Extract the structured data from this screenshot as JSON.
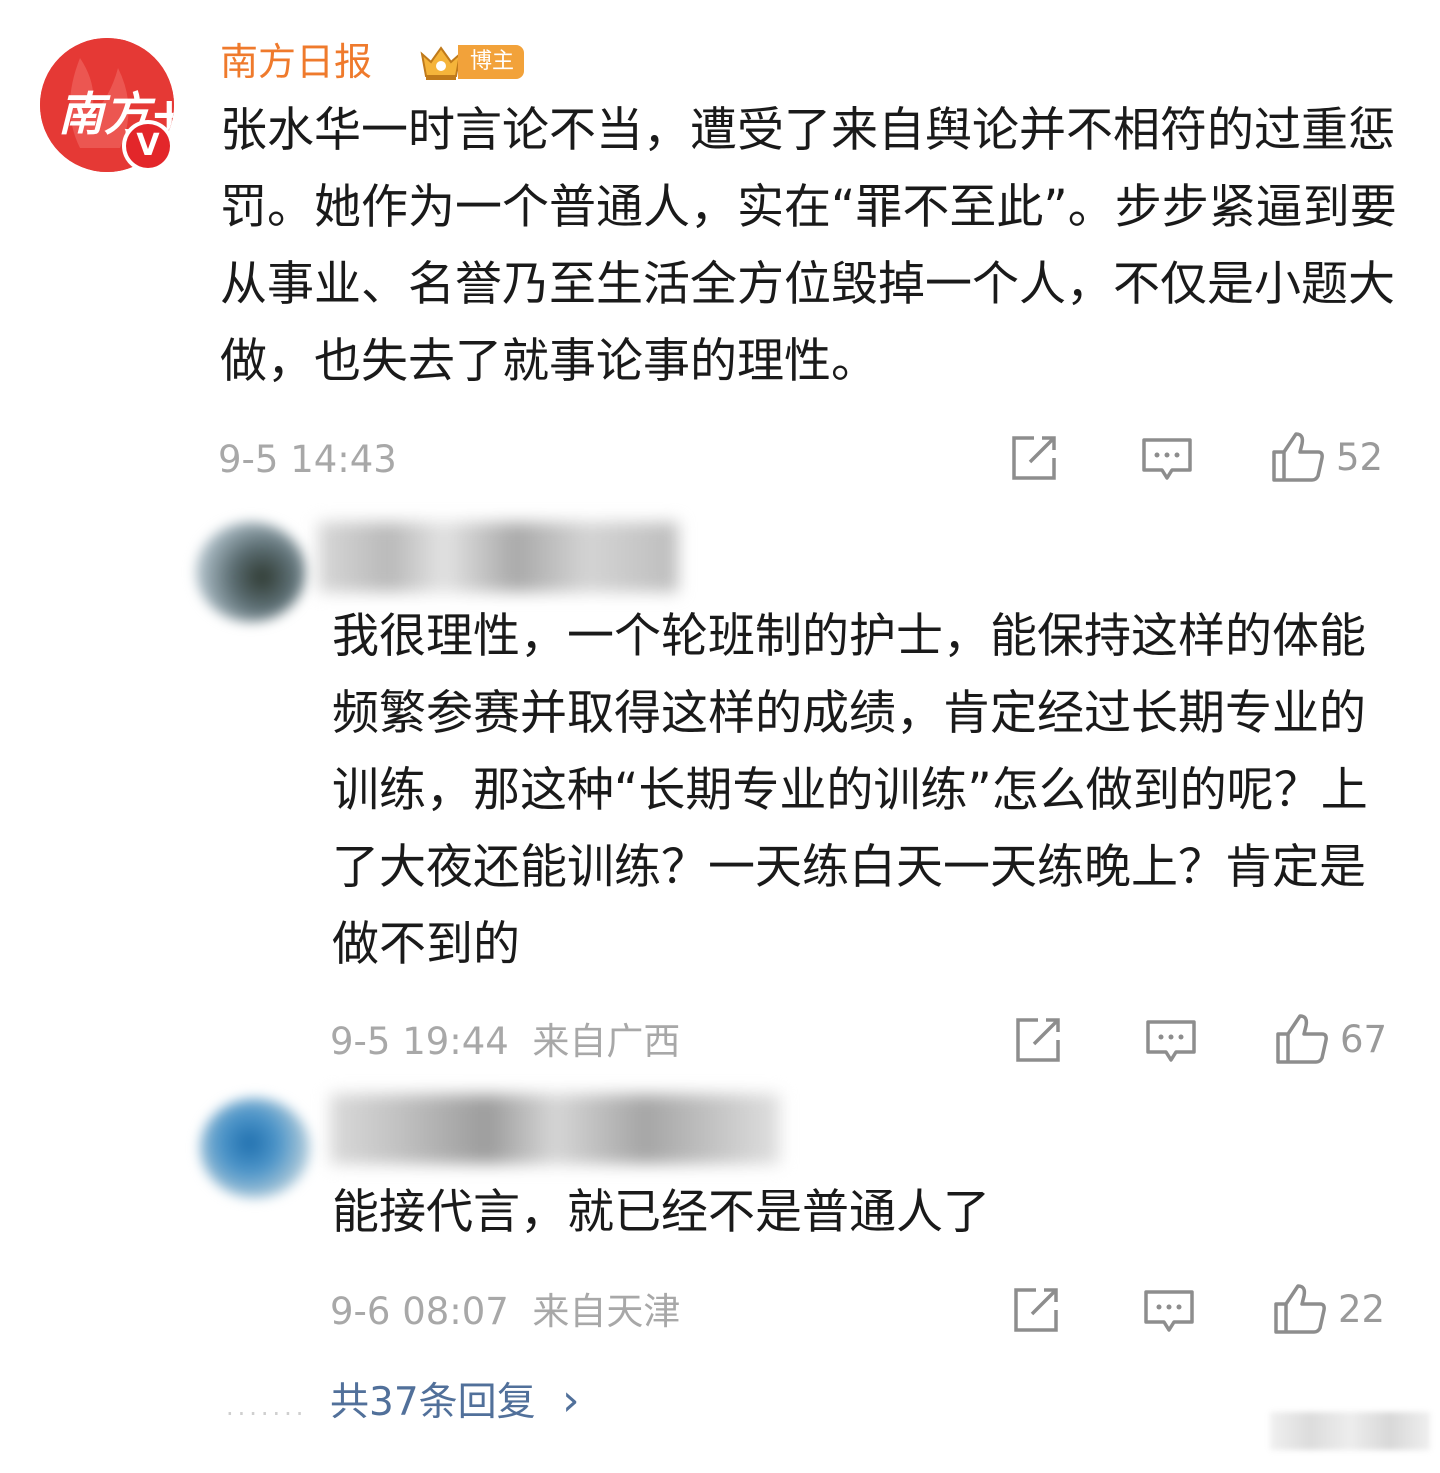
{
  "post": {
    "author": "南方日报",
    "avatar_text": "南方+",
    "verified_label": "V",
    "badge_label": "博主",
    "text": "张水华一时言论不当，遭受了来自舆论并不相符的过重惩罚。她作为一个普通人，实在“罪不至此”。步步紧逼到要从事业、名誉乃至生活全方位毁掉一个人，不仅是小题大做，也失去了就事论事的理性。",
    "time": "9-5 14:43",
    "likes": "52"
  },
  "replies": [
    {
      "text": "我很理性，一个轮班制的护士，能保持这样的体能频繁参赛并取得这样的成绩，肯定经过长期专业的训练，那这种“长期专业的训练”怎么做到的呢？上了大夜还能训练？一天练白天一天练晚上？肯定是做不到的",
      "time": "9-5 19:44",
      "location": "来自广西",
      "likes": "67"
    },
    {
      "text": "能接代言，就已经不是普通人了",
      "time": "9-6 08:07",
      "location": "来自天津",
      "likes": "22"
    }
  ],
  "more_replies": "共37条回复",
  "more_chevron": "›",
  "dots": "·······",
  "icons": [
    "share-icon",
    "comment-icon",
    "like-icon",
    "chevron-right-icon",
    "crown-icon"
  ],
  "colors": {
    "author": "#ef7a2c",
    "badge": "#f2a23a",
    "link": "#51709a",
    "verified": "#e3262a"
  }
}
